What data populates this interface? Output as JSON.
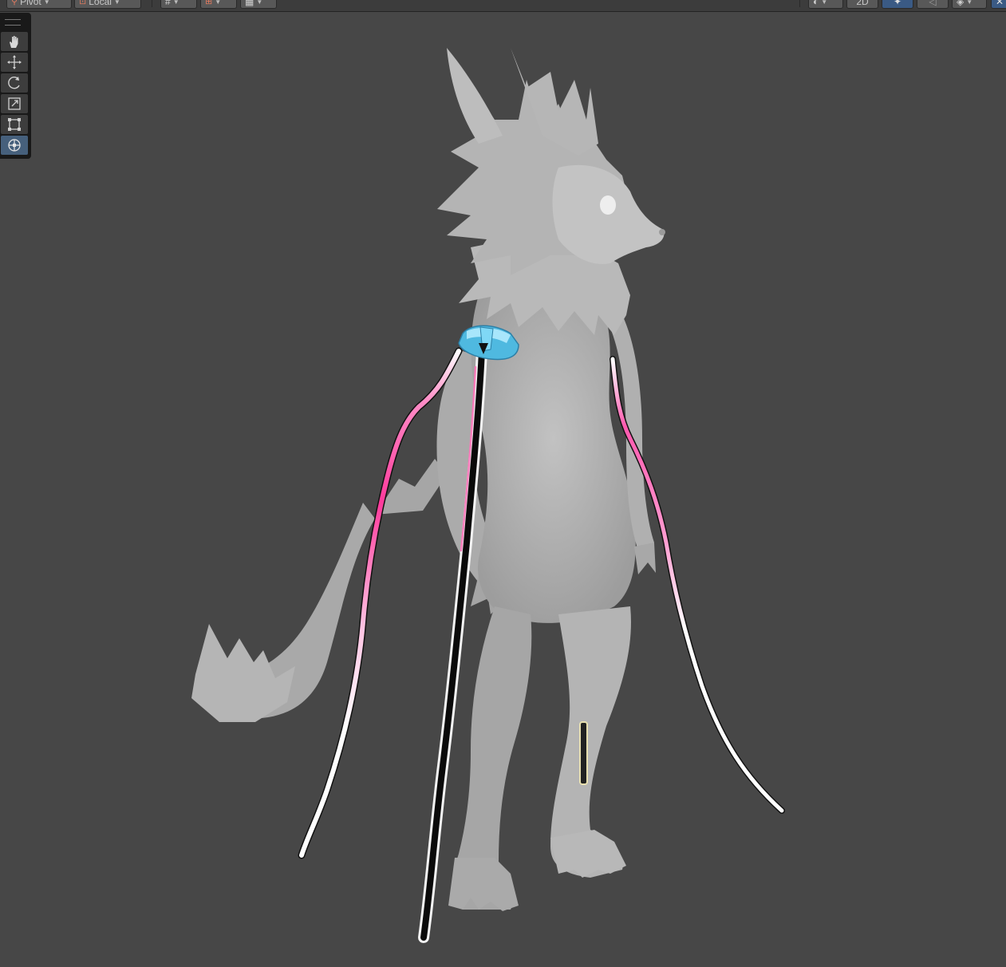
{
  "toolbar": {
    "pivot_label": "Pivot",
    "local_label": "Local",
    "mode_2d_label": "2D"
  },
  "tool_palette": {
    "tools": [
      {
        "name": "hand-tool",
        "icon": "hand-icon",
        "selected": false
      },
      {
        "name": "move-tool",
        "icon": "move-arrows-icon",
        "selected": false
      },
      {
        "name": "rotate-tool",
        "icon": "rotate-icon",
        "selected": false
      },
      {
        "name": "scale-tool",
        "icon": "scale-icon",
        "selected": false
      },
      {
        "name": "rect-tool",
        "icon": "rect-transform-icon",
        "selected": false
      },
      {
        "name": "transform-tool",
        "icon": "transform-icon",
        "selected": true
      }
    ]
  },
  "scene": {
    "background_color": "#474747",
    "model_color": "#b7b7b7",
    "armband_color": "#5fc8ec",
    "ribbon_colors": [
      "#ff4fa8",
      "#ffffff",
      "#000000"
    ]
  }
}
